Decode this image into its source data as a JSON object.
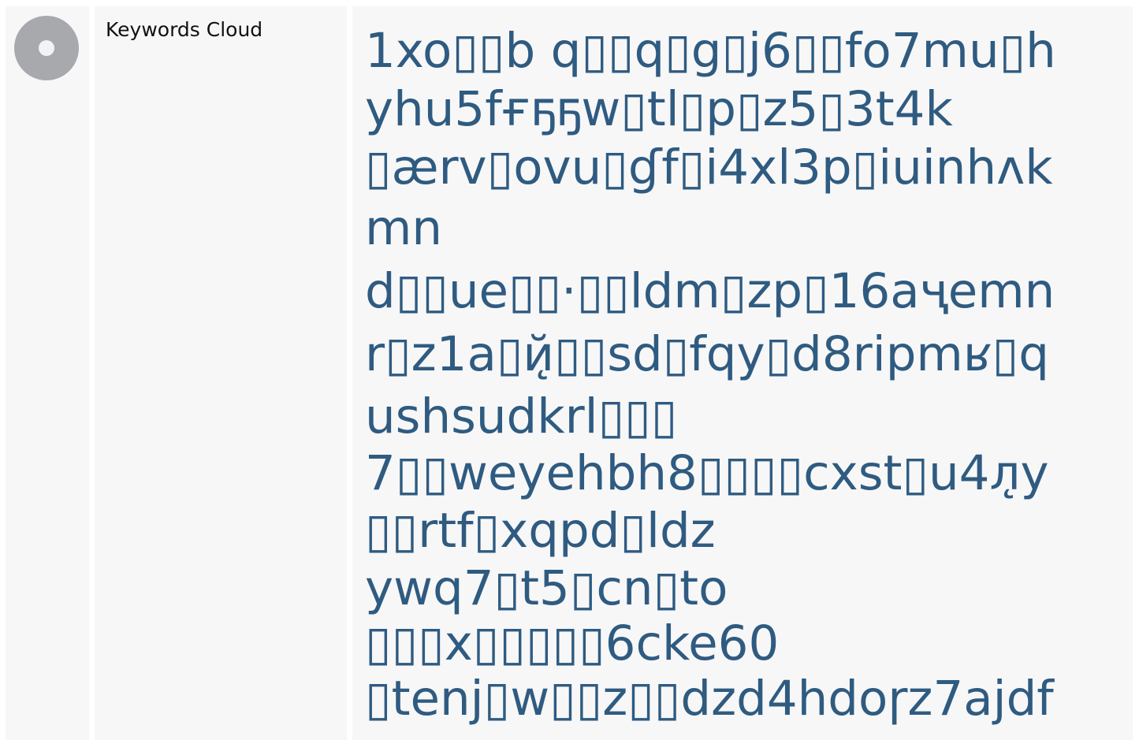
{
  "section": {
    "title": "Keywords Cloud",
    "icon": "disc-icon"
  },
  "cloud": {
    "color": "#2f5b81",
    "lines": [
      "1xo▯▯b q▯▯q▯g▯j6▯▯fo7mu▯h",
      "yhu5fғҕҕw▯tl▯p▯z5▯3t4k",
      "▯ærv▯ovu▯ɠf▯i4xl3p▯iuinhʌk",
      "mn",
      "d▯▯ue▯▯·▯▯ldm▯zp▯16aҷemn",
      "r▯z1a▯й̨▯▯sd▯fqy▯d8ripmʁ▯q",
      "ushsudkrl▯▯▯",
      "7▯▯weyehbh8▯▯▯▯cxst▯u4л̨y",
      "▯▯rtf▯xqpd▯ldz",
      "ywq7▯t5▯cn▯to",
      "▯▯▯x▯▯▯▯▯6cke60",
      "▯tenj▯w▯▯z▯▯dzd4hdoɼz7ajdf"
    ]
  }
}
